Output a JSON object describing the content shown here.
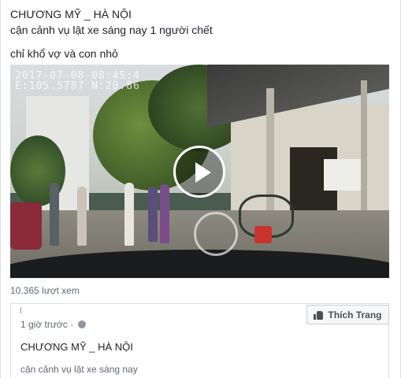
{
  "post": {
    "lines": [
      "CHƯƠNG MỸ _ HÀ NỘI",
      "cận cảnh vụ lật xe sáng nay 1 người chết",
      "chỉ khổ vợ và con nhỏ"
    ]
  },
  "video": {
    "overlay_line1": "2017-07-08 08:45:4",
    "overlay_line2": "E:105.5787 N:20.86",
    "play_icon": "play-icon"
  },
  "views": "10.365 lượt xem",
  "shared_post": {
    "time": "1 giờ trước ·",
    "page_name": "CHƯƠNG MỸ _ HÀ NỘI",
    "description": "cận cảnh vụ lật xe sáng nay"
  },
  "like_page_button": {
    "label": "Thích Trang",
    "icon": "thumbs-up-icon"
  }
}
